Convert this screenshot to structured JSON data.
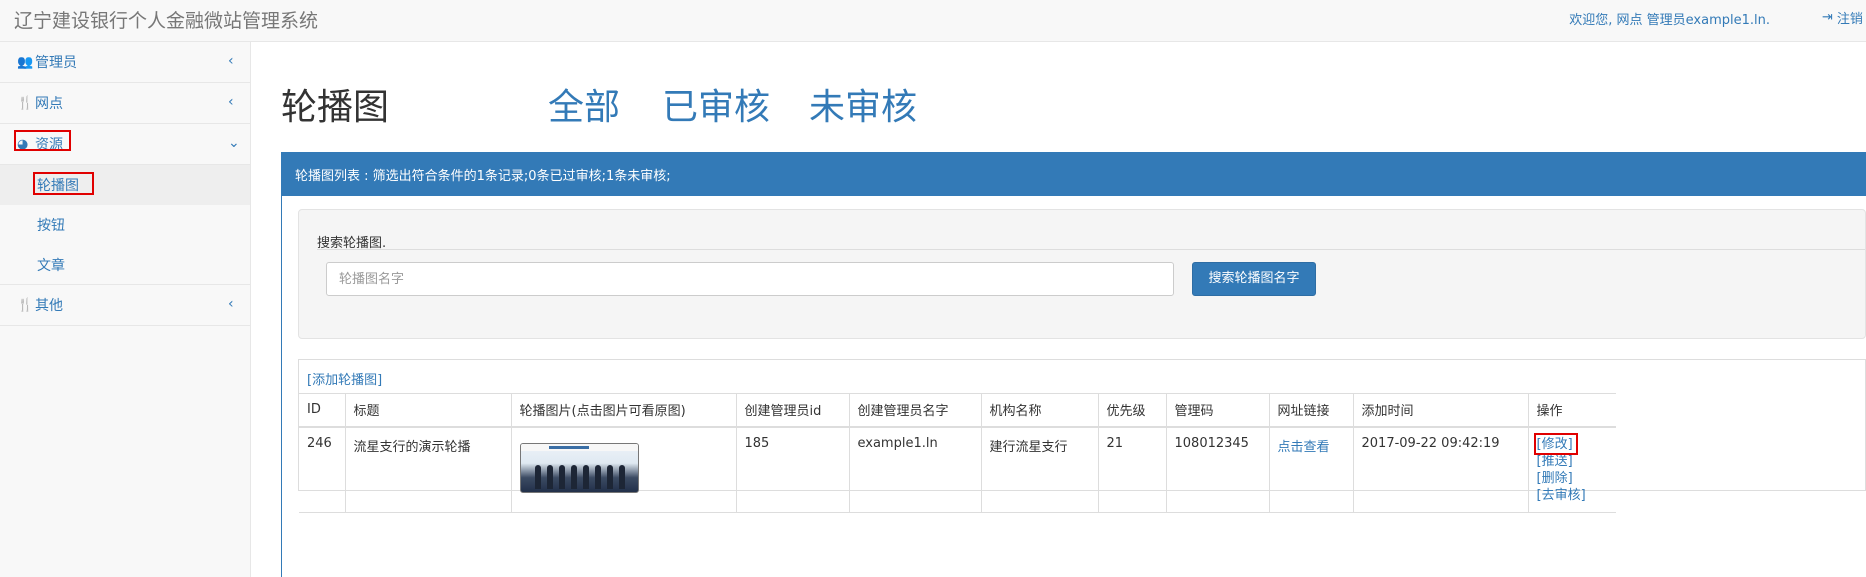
{
  "header": {
    "brand": "辽宁建设银行个人金融微站管理系统",
    "welcome": "欢迎您, 网点 管理员example1.ln.",
    "logout": "注销"
  },
  "sidebar": {
    "items": [
      {
        "icon": "users-icon",
        "label": "管理员",
        "chevron": "‹"
      },
      {
        "icon": "cutlery-icon",
        "label": "网点",
        "chevron": "‹"
      },
      {
        "icon": "pie-icon",
        "label": "资源",
        "chevron": "⌄"
      },
      {
        "icon": "cutlery-icon",
        "label": "其他",
        "chevron": "‹"
      }
    ],
    "subitems": [
      {
        "label": "轮播图",
        "active": true
      },
      {
        "label": "按钮",
        "active": false
      },
      {
        "label": "文章",
        "active": false
      }
    ]
  },
  "main": {
    "title": "轮播图",
    "filters": [
      "全部",
      "已审核",
      "未审核"
    ],
    "panel_heading": "轮播图列表 : 筛选出符合条件的1条记录;0条已过审核;1条未审核;",
    "search": {
      "label": "搜索轮播图.",
      "placeholder": "轮播图名字",
      "button": "搜索轮播图名字"
    },
    "add_link": "[添加轮播图]",
    "table": {
      "headers": [
        "ID",
        "标题",
        "轮播图片(点击图片可看原图)",
        "创建管理员id",
        "创建管理员名字",
        "机构名称",
        "优先级",
        "管理码",
        "网址链接",
        "添加时间",
        "操作"
      ],
      "rows": [
        {
          "id": "246",
          "title": "流星支行的演示轮播",
          "admin_id": "185",
          "admin_name": "example1.ln",
          "org": "建行流星支行",
          "priority": "21",
          "code": "108012345",
          "link": "点击查看",
          "time": "2017-09-22 09:42:19",
          "ops": [
            "[修改]",
            "[推送]",
            "[删除]",
            "[去审核]"
          ]
        }
      ]
    }
  },
  "colors": {
    "accent": "#337ab7",
    "highlight": "#e00000"
  }
}
